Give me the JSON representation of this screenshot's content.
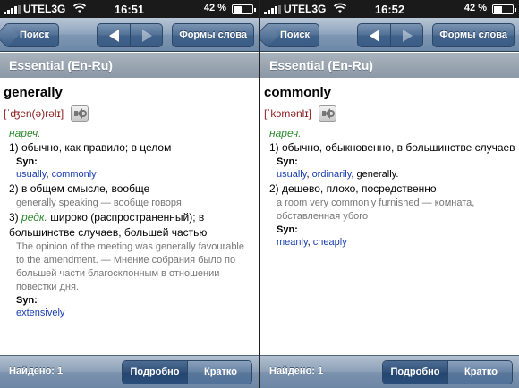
{
  "status": {
    "carrier": "UTEL3G",
    "battery_pct": "42 %",
    "left_time": "16:51",
    "right_time": "16:52"
  },
  "nav": {
    "back_label": "Поиск",
    "forms_label": "Формы слова"
  },
  "dict_title": "Essential (En-Ru)",
  "toolbar": {
    "found_label": "Найдено: 1",
    "detailed_label": "Подробно",
    "brief_label": "Кратко"
  },
  "left": {
    "headword": "generally",
    "pron": "[ˈʤen(ə)rəlɪ]",
    "pos": "нареч.",
    "senses": [
      {
        "text": "1) обычно, как правило; в целом"
      },
      {
        "text": "2) в общем смысле, вообще"
      },
      {
        "label": "редк.",
        "text": "3) широко (распространенный); в большинстве случаев, большей частью"
      }
    ],
    "syn_label": "Syn:",
    "syn1": [
      "usually",
      "commonly"
    ],
    "example2": "generally speaking — вообще говоря",
    "example3": "The opinion of the meeting was generally favourable to the amendment. — Мнение собрания было по большей части благосклонным в отношении повестки дня.",
    "syn3": [
      "extensively"
    ]
  },
  "right": {
    "headword": "commonly",
    "pron": "[ˈkɔmənlɪ]",
    "pos": "нареч.",
    "senses": [
      {
        "text": "1) обычно, обыкновенно, в большинстве случаев"
      },
      {
        "text": "2) дешево, плохо, посредственно"
      }
    ],
    "syn_label": "Syn:",
    "syn1": [
      "usually",
      "ordinarily",
      "generally."
    ],
    "example2": "a room very commonly furnished — комната, обставленная убого",
    "syn2": [
      "meanly",
      "cheaply"
    ]
  }
}
